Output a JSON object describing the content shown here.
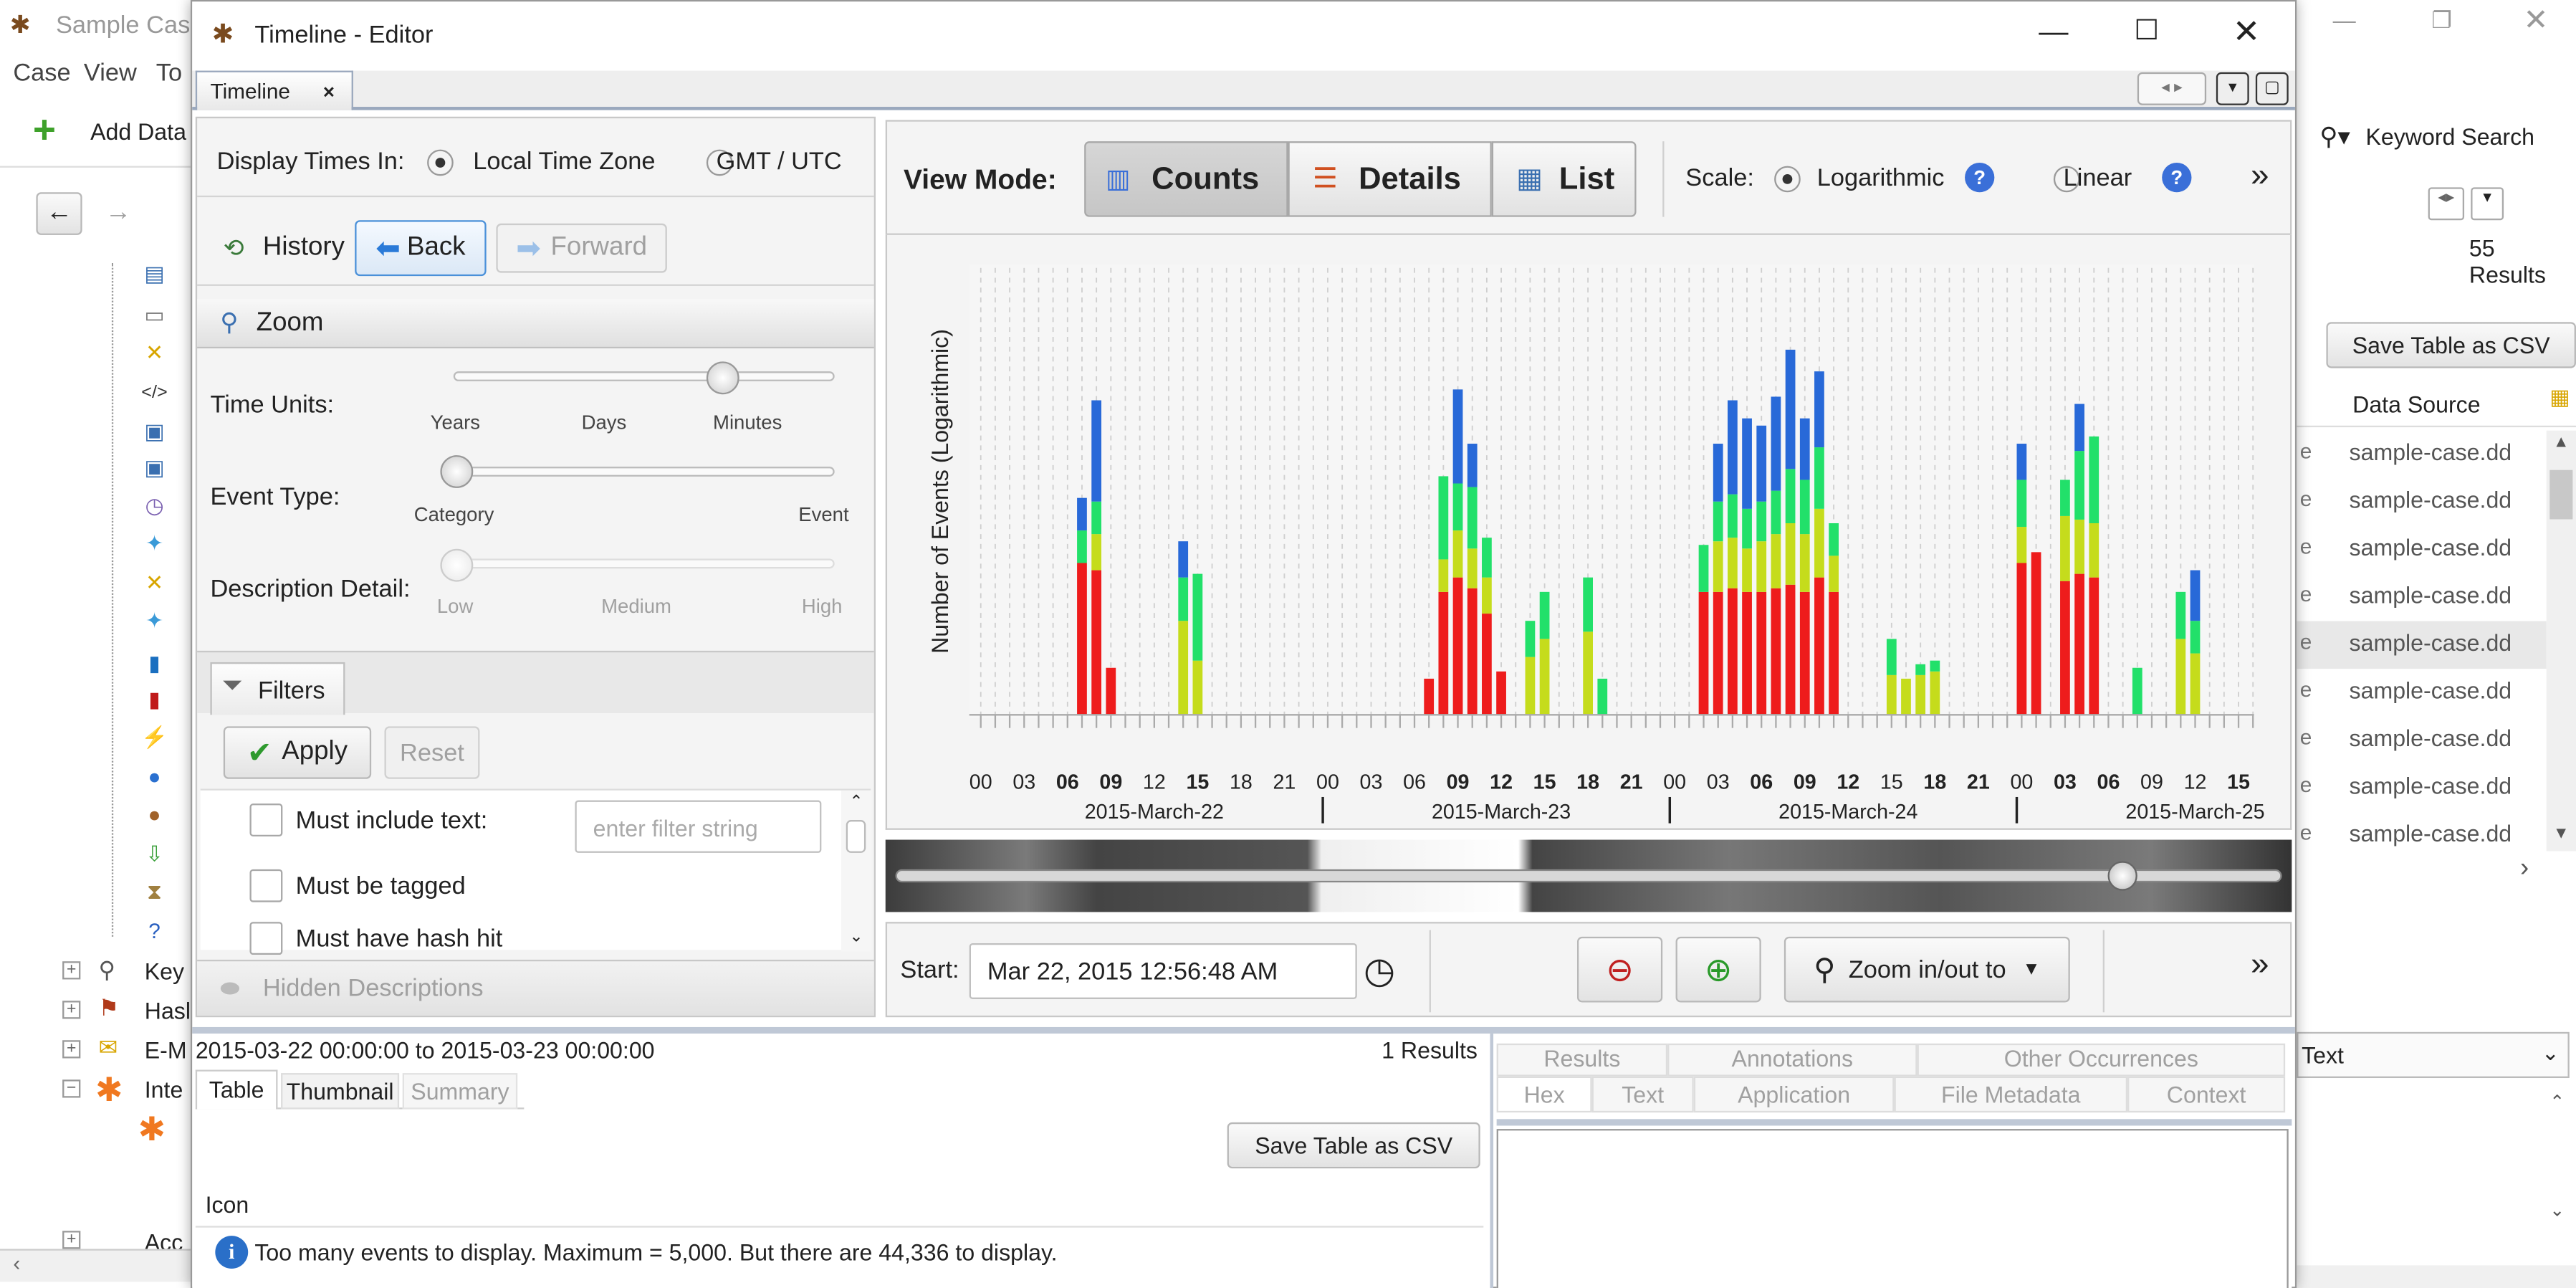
{
  "bg_app": {
    "title": "Sample Cas",
    "menu": [
      "Case",
      "View",
      "To"
    ],
    "add_data": "Add Data",
    "keyword_search": "Keyword Search",
    "results_count": "55  Results",
    "save_csv": "Save Table as CSV",
    "data_source_header": "Data Source",
    "row_prefix": "e",
    "rows": [
      "sample-case.dd",
      "sample-case.dd",
      "sample-case.dd",
      "sample-case.dd",
      "sample-case.dd",
      "sample-case.dd",
      "sample-case.dd",
      "sample-case.dd",
      "sample-case.dd"
    ],
    "text_dropdown": "Text",
    "tree_labels": [
      "Key",
      "Hasl",
      "E-M",
      "Inte",
      "Acc"
    ]
  },
  "window": {
    "title": "Timeline - Editor",
    "tab": "Timeline"
  },
  "display_times": {
    "label": "Display Times In:",
    "local": "Local Time Zone",
    "gmt": "GMT / UTC"
  },
  "history": {
    "label": "History",
    "back": "Back",
    "forward": "Forward"
  },
  "zoom": {
    "title": "Zoom",
    "time_units": "Time Units:",
    "time_ticks": [
      "Years",
      "Days",
      "Minutes"
    ],
    "time_level": 0.7,
    "event_type": "Event Type:",
    "event_ticks": [
      "Category",
      "Event"
    ],
    "event_level": 0.0,
    "desc_detail": "Description Detail:",
    "desc_ticks": [
      "Low",
      "Medium",
      "High"
    ],
    "desc_level": 0.0
  },
  "filters": {
    "title": "Filters",
    "apply": "Apply",
    "reset": "Reset",
    "must_include_text": "Must include text:",
    "placeholder": "enter filter string",
    "must_be_tagged": "Must be tagged",
    "must_have_hash": "Must have hash hit",
    "hidden_desc": "Hidden Descriptions"
  },
  "view_mode": {
    "label": "View Mode:",
    "counts": "Counts",
    "details": "Details",
    "list": "List",
    "scale": "Scale:",
    "log": "Logarithmic",
    "linear": "Linear",
    "more": "»"
  },
  "nav": {
    "start_label": "Start:",
    "start_value": "Mar 22, 2015 12:56:48 AM",
    "zoom_to": "Zoom in/out to",
    "more": "»"
  },
  "result_bar": {
    "range": "2015-03-22 00:00:00 to 2015-03-23 00:00:00",
    "count": "1  Results"
  },
  "bottom_tabs": {
    "table": "Table",
    "thumbnail": "Thumbnail",
    "summary": "Summary",
    "save_csv": "Save Table as CSV",
    "icon_col": "Icon",
    "message": "Too many events to display.  Maximum = 5,000. But there are 44,336 to display."
  },
  "content_tabs": {
    "row1": [
      "Results",
      "Annotations",
      "Other Occurrences"
    ],
    "row2": [
      "Hex",
      "Text",
      "Application",
      "File Metadata",
      "Context"
    ]
  },
  "colors": {
    "red": "#ee1c1c",
    "lime": "#c5dc1c",
    "green": "#22e06a",
    "blue": "#2869d8",
    "accent": "#4a90d9"
  },
  "chart_data": {
    "type": "bar",
    "stacked": true,
    "ylabel": "Number of Events (Logarithmic)",
    "scale": "logarithmic",
    "hour_ticks": [
      "00",
      "03",
      "06",
      "09",
      "12",
      "15",
      "18",
      "21",
      "00",
      "03",
      "06",
      "09",
      "12",
      "15",
      "18",
      "21",
      "00",
      "03",
      "06",
      "09",
      "12",
      "15",
      "18",
      "21",
      "00",
      "03",
      "06",
      "09",
      "12",
      "15"
    ],
    "bold_ticks": [
      2,
      3,
      5,
      11,
      12,
      13,
      14,
      15,
      18,
      19,
      20,
      22,
      23,
      25,
      26,
      29
    ],
    "days": [
      "2015-March-22",
      "2015-March-23",
      "2015-March-24",
      "2015-March-25"
    ],
    "series_names": [
      "red",
      "lime",
      "green",
      "blue"
    ],
    "bars": [
      {
        "hour": 7.0,
        "values": [
          4.2,
          0,
          0.9,
          0.9
        ]
      },
      {
        "hour": 8.0,
        "values": [
          4.0,
          1.0,
          0.9,
          2.8
        ]
      },
      {
        "hour": 9.0,
        "values": [
          1.3,
          0,
          0,
          0
        ]
      },
      {
        "hour": 14.0,
        "values": [
          0,
          2.6,
          1.2,
          1.0
        ]
      },
      {
        "hour": 15.0,
        "values": [
          0,
          1.5,
          2.4,
          0
        ]
      },
      {
        "hour": 31.0,
        "values": [
          1.0,
          0,
          0,
          0
        ]
      },
      {
        "hour": 32.0,
        "values": [
          3.4,
          0.9,
          2.3,
          0
        ]
      },
      {
        "hour": 33.0,
        "values": [
          3.8,
          1.3,
          1.3,
          2.6
        ]
      },
      {
        "hour": 34.0,
        "values": [
          3.5,
          1.1,
          1.7,
          1.2
        ]
      },
      {
        "hour": 35.0,
        "values": [
          2.8,
          1.0,
          1.1,
          0
        ]
      },
      {
        "hour": 36.0,
        "values": [
          1.2,
          0,
          0,
          0
        ]
      },
      {
        "hour": 38.0,
        "values": [
          0,
          1.6,
          1.0,
          0
        ]
      },
      {
        "hour": 39.0,
        "values": [
          0,
          2.1,
          1.3,
          0
        ]
      },
      {
        "hour": 42.0,
        "values": [
          0,
          2.3,
          1.5,
          0
        ]
      },
      {
        "hour": 43.0,
        "values": [
          0,
          0,
          1.0,
          0
        ]
      },
      {
        "hour": 50.0,
        "values": [
          3.4,
          0,
          1.3,
          0
        ]
      },
      {
        "hour": 51.0,
        "values": [
          3.4,
          1.4,
          1.1,
          1.6
        ]
      },
      {
        "hour": 52.0,
        "values": [
          3.5,
          1.4,
          1.2,
          2.6
        ]
      },
      {
        "hour": 53.0,
        "values": [
          3.4,
          1.2,
          1.1,
          2.5
        ]
      },
      {
        "hour": 54.0,
        "values": [
          3.4,
          1.4,
          1.1,
          2.1
        ]
      },
      {
        "hour": 55.0,
        "values": [
          3.5,
          1.5,
          1.2,
          2.6
        ]
      },
      {
        "hour": 56.0,
        "values": [
          3.6,
          1.7,
          1.5,
          3.3
        ]
      },
      {
        "hour": 57.0,
        "values": [
          3.4,
          1.6,
          1.5,
          1.7
        ]
      },
      {
        "hour": 58.0,
        "values": [
          3.8,
          1.9,
          1.7,
          2.1
        ]
      },
      {
        "hour": 59.0,
        "values": [
          3.4,
          1.0,
          0.9,
          0
        ]
      },
      {
        "hour": 63.0,
        "values": [
          0,
          1.1,
          1.0,
          0
        ]
      },
      {
        "hour": 64.0,
        "values": [
          0,
          1.0,
          0,
          0
        ]
      },
      {
        "hour": 65.0,
        "values": [
          0,
          1.1,
          0.3,
          0
        ]
      },
      {
        "hour": 66.0,
        "values": [
          0,
          1.2,
          0.3,
          0
        ]
      },
      {
        "hour": 72.0,
        "values": [
          4.2,
          1.0,
          1.3,
          1.0
        ]
      },
      {
        "hour": 73.0,
        "values": [
          4.5,
          0,
          0,
          0
        ]
      },
      {
        "hour": 75.0,
        "values": [
          3.7,
          1.8,
          1.0,
          0
        ]
      },
      {
        "hour": 76.0,
        "values": [
          3.9,
          1.5,
          1.9,
          1.3
        ]
      },
      {
        "hour": 77.0,
        "values": [
          3.8,
          1.5,
          2.4,
          0
        ]
      },
      {
        "hour": 80.0,
        "values": [
          0,
          0,
          1.3,
          0
        ]
      },
      {
        "hour": 83.0,
        "values": [
          0,
          2.1,
          1.3,
          0
        ]
      },
      {
        "hour": 84.0,
        "values": [
          0,
          1.7,
          0.9,
          1.4
        ]
      }
    ]
  }
}
